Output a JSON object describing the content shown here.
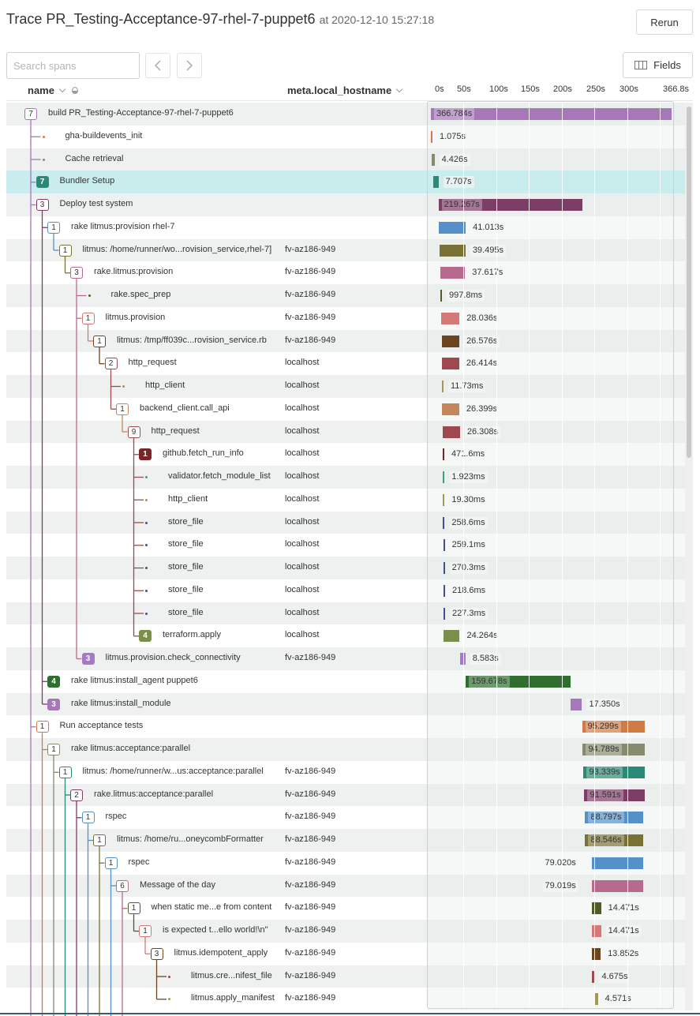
{
  "header": {
    "title": "Trace PR_Testing-Acceptance-97-rhel-7-puppet6",
    "timestamp": "at 2020-12-10 15:27:18",
    "rerun_label": "Rerun"
  },
  "toolbar": {
    "search_placeholder": "Search spans",
    "search_value": "",
    "fields_label": "Fields"
  },
  "columns": {
    "name": "name",
    "hostname": "meta.local_hostname"
  },
  "timeline": {
    "max_seconds": 366.8,
    "ticks": [
      "0s",
      "50s",
      "100s",
      "150s",
      "200s",
      "250s",
      "300s",
      "366.8s"
    ],
    "tick_values": [
      0,
      50,
      100,
      150,
      200,
      250,
      300,
      366.8
    ]
  },
  "spans": [
    {
      "name": "build PR_Testing-Acceptance-97-rhel-7-puppet6",
      "host": "",
      "depth": 0,
      "children": 7,
      "filled": false,
      "color": "#a678b8",
      "start": 0,
      "duration": 366.784,
      "label": "366.784s",
      "selected": false
    },
    {
      "name": "gha-buildevents_init",
      "host": "",
      "depth": 1,
      "children": 0,
      "color": "#d97a45",
      "start": 0,
      "duration": 1.075,
      "label": "1.075s"
    },
    {
      "name": "Cache retrieval",
      "host": "",
      "depth": 1,
      "children": 0,
      "color": "#868a6e",
      "start": 1.1,
      "duration": 4.426,
      "label": "4.426s"
    },
    {
      "name": "Bundler Setup",
      "host": "",
      "depth": 1,
      "children": 7,
      "filled": true,
      "color": "#2a8a76",
      "start": 3.8,
      "duration": 7.707,
      "label": "7.707s",
      "selected": true
    },
    {
      "name": "Deploy test system",
      "host": "",
      "depth": 1,
      "children": 3,
      "filled": false,
      "color": "#7c3d66",
      "start": 11.5,
      "duration": 219.267,
      "label": "219.267s"
    },
    {
      "name": "rake litmus:provision rhel-7",
      "host": "",
      "depth": 2,
      "children": 1,
      "filled": false,
      "color": "#5590c8",
      "start": 12,
      "duration": 41.013,
      "label": "41.013s"
    },
    {
      "name": "litmus: /home/runner/wo...rovision_service,rhel-7]",
      "host": "fv-az186-949",
      "depth": 3,
      "children": 1,
      "filled": false,
      "color": "#7a7234",
      "start": 13.2,
      "duration": 39.495,
      "label": "39.495s"
    },
    {
      "name": "rake.litmus:provision",
      "host": "fv-az186-949",
      "depth": 4,
      "children": 3,
      "filled": false,
      "color": "#b86a8e",
      "start": 14.4,
      "duration": 37.617,
      "label": "37.617s"
    },
    {
      "name": "rake.spec_prep",
      "host": "fv-az186-949",
      "depth": 5,
      "children": 0,
      "color": "#4e5c25",
      "start": 14.4,
      "duration": 0.9978,
      "label": "997.8ms"
    },
    {
      "name": "litmus.provision",
      "host": "fv-az186-949",
      "depth": 5,
      "children": 1,
      "filled": false,
      "color": "#d47878",
      "start": 15.6,
      "duration": 28.036,
      "label": "28.036s"
    },
    {
      "name": "litmus: /tmp/ff039c...rovision_service.rb",
      "host": "fv-az186-949",
      "depth": 6,
      "children": 1,
      "filled": false,
      "color": "#6b4520",
      "start": 16.8,
      "duration": 26.576,
      "label": "26.576s"
    },
    {
      "name": "http_request",
      "host": "localhost",
      "depth": 7,
      "children": 2,
      "filled": false,
      "color": "#a04850",
      "start": 16.8,
      "duration": 26.414,
      "label": "26.414s"
    },
    {
      "name": "http_client",
      "host": "localhost",
      "depth": 8,
      "children": 0,
      "color": "#a09a55",
      "start": 16.8,
      "duration": 0.01173,
      "label": "11.73ms"
    },
    {
      "name": "backend_client.call_api",
      "host": "localhost",
      "depth": 8,
      "children": 1,
      "filled": false,
      "color": "#c4865a",
      "start": 16.8,
      "duration": 26.399,
      "label": "26.399s"
    },
    {
      "name": "http_request",
      "host": "localhost",
      "depth": 9,
      "children": 9,
      "filled": false,
      "color": "#a04850",
      "start": 18,
      "duration": 26.308,
      "label": "26.308s"
    },
    {
      "name": "github.fetch_run_info",
      "host": "localhost",
      "depth": 10,
      "children": 1,
      "filled": true,
      "color": "#7a2428",
      "start": 18,
      "duration": 0.4716,
      "label": "471.6ms"
    },
    {
      "name": "validator.fetch_module_list",
      "host": "localhost",
      "depth": 10,
      "children": 0,
      "color": "#3aa078",
      "start": 18.5,
      "duration": 0.001923,
      "label": "1.923ms"
    },
    {
      "name": "http_client",
      "host": "localhost",
      "depth": 10,
      "children": 0,
      "color": "#a09a55",
      "start": 18.5,
      "duration": 0.0193,
      "label": "19.30ms"
    },
    {
      "name": "store_file",
      "host": "localhost",
      "depth": 10,
      "children": 0,
      "color": "#3f4f90",
      "start": 18.5,
      "duration": 0.2586,
      "label": "258.6ms"
    },
    {
      "name": "store_file",
      "host": "localhost",
      "depth": 10,
      "children": 0,
      "color": "#3f4f90",
      "start": 18.8,
      "duration": 0.2591,
      "label": "259.1ms"
    },
    {
      "name": "store_file",
      "host": "localhost",
      "depth": 10,
      "children": 0,
      "color": "#3f4f90",
      "start": 18.8,
      "duration": 0.2703,
      "label": "270.3ms"
    },
    {
      "name": "store_file",
      "host": "localhost",
      "depth": 10,
      "children": 0,
      "color": "#3f4f90",
      "start": 19.2,
      "duration": 0.2186,
      "label": "218.6ms"
    },
    {
      "name": "store_file",
      "host": "localhost",
      "depth": 10,
      "children": 0,
      "color": "#3f4f90",
      "start": 19.2,
      "duration": 0.2273,
      "label": "227.3ms"
    },
    {
      "name": "terraform.apply",
      "host": "localhost",
      "depth": 10,
      "children": 4,
      "filled": true,
      "color": "#7a9048",
      "start": 19.6,
      "duration": 24.264,
      "label": "24.264s"
    },
    {
      "name": "litmus.provision.check_connectivity",
      "host": "fv-az186-949",
      "depth": 5,
      "children": 3,
      "filled": true,
      "color": "#a678c8",
      "start": 44,
      "duration": 8.583,
      "label": "8.583s"
    },
    {
      "name": "rake litmus:install_agent puppet6",
      "host": "",
      "depth": 2,
      "children": 4,
      "filled": true,
      "color": "#2e6e30",
      "start": 53.2,
      "duration": 159.678,
      "label": "159.678s"
    },
    {
      "name": "rake litmus:install_module",
      "host": "",
      "depth": 2,
      "children": 3,
      "filled": true,
      "color": "#a678b8",
      "start": 212.9,
      "duration": 17.35,
      "label": "17.350s"
    },
    {
      "name": "Run acceptance tests",
      "host": "",
      "depth": 1,
      "children": 1,
      "filled": false,
      "color": "#d07a45",
      "start": 230.4,
      "duration": 95.299,
      "label": "95.299s"
    },
    {
      "name": "rake litmus:acceptance:parallel",
      "host": "",
      "depth": 2,
      "children": 1,
      "filled": false,
      "color": "#868a6e",
      "start": 231.5,
      "duration": 94.789,
      "label": "94.789s"
    },
    {
      "name": "litmus: /home/runner/w...us:acceptance:parallel",
      "host": "fv-az186-949",
      "depth": 3,
      "children": 1,
      "filled": false,
      "color": "#2a8a76",
      "start": 232.7,
      "duration": 93.339,
      "label": "93.339s"
    },
    {
      "name": "rake.litmus:acceptance:parallel",
      "host": "fv-az186-949",
      "depth": 4,
      "children": 2,
      "filled": false,
      "color": "#7c3d66",
      "start": 233.9,
      "duration": 91.591,
      "label": "91.591s"
    },
    {
      "name": "rspec",
      "host": "fv-az186-949",
      "depth": 5,
      "children": 1,
      "filled": false,
      "color": "#5590c8",
      "start": 235.1,
      "duration": 88.797,
      "label": "88.797s"
    },
    {
      "name": "litmus: /home/ru...oneycombFormatter",
      "host": "fv-az186-949",
      "depth": 6,
      "children": 1,
      "filled": false,
      "color": "#7a7234",
      "start": 235.1,
      "duration": 88.546,
      "label": "88.546s"
    },
    {
      "name": "rspec",
      "host": "fv-az186-949",
      "depth": 7,
      "children": 1,
      "filled": false,
      "color": "#5590c8",
      "start": 244.8,
      "duration": 79.02,
      "label": "79.020s"
    },
    {
      "name": "Message of the day",
      "host": "fv-az186-949",
      "depth": 8,
      "children": 6,
      "filled": false,
      "color": "#b86a8e",
      "start": 244.8,
      "duration": 79.019,
      "label": "79.019s"
    },
    {
      "name": "when static me...e from content",
      "host": "fv-az186-949",
      "depth": 9,
      "children": 1,
      "filled": false,
      "color": "#4e5c25",
      "start": 244.8,
      "duration": 14.471,
      "label": "14.471s"
    },
    {
      "name": "is expected t...ello world!\\n\"",
      "host": "fv-az186-949",
      "depth": 10,
      "children": 1,
      "filled": false,
      "color": "#d47878",
      "start": 244.8,
      "duration": 14.471,
      "label": "14.471s"
    },
    {
      "name": "litmus.idempotent_apply",
      "host": "fv-az186-949",
      "depth": 11,
      "children": 3,
      "filled": false,
      "color": "#6b4520",
      "start": 244.8,
      "duration": 13.852,
      "label": "13.852s"
    },
    {
      "name": "litmus.cre...nifest_file",
      "host": "fv-az186-949",
      "depth": 12,
      "children": 0,
      "color": "#a04850",
      "start": 244.8,
      "duration": 4.675,
      "label": "4.675s"
    },
    {
      "name": "litmus.apply_manifest",
      "host": "fv-az186-949",
      "depth": 12,
      "children": 0,
      "color": "#a09a55",
      "start": 250,
      "duration": 4.571,
      "label": "4.571s"
    }
  ]
}
